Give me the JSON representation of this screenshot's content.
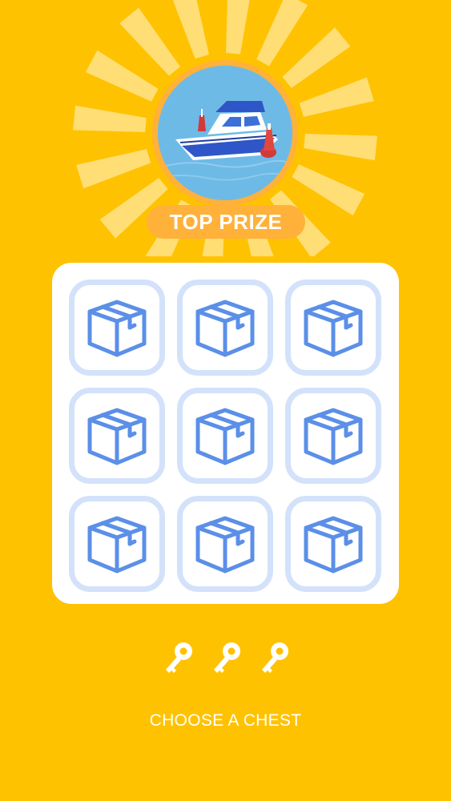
{
  "prize": {
    "label": "TOP PRIZE",
    "image_icon": "motorboat"
  },
  "chests": [
    {
      "icon": "box-icon"
    },
    {
      "icon": "box-icon"
    },
    {
      "icon": "box-icon"
    },
    {
      "icon": "box-icon"
    },
    {
      "icon": "box-icon"
    },
    {
      "icon": "box-icon"
    },
    {
      "icon": "box-icon"
    },
    {
      "icon": "box-icon"
    },
    {
      "icon": "box-icon"
    }
  ],
  "keys": {
    "count": 3,
    "icon": "key-icon"
  },
  "instruction": "CHOOSE A CHEST",
  "colors": {
    "background": "#FFC200",
    "badge": "#FFB13A",
    "sun_rays": "#FFE38A",
    "prize_water": "#6EBAE6",
    "chest_border": "#D3E2FA",
    "chest_icon": "#5B8FE8",
    "panel": "#FFFFFF",
    "text": "#FFFFFF"
  }
}
